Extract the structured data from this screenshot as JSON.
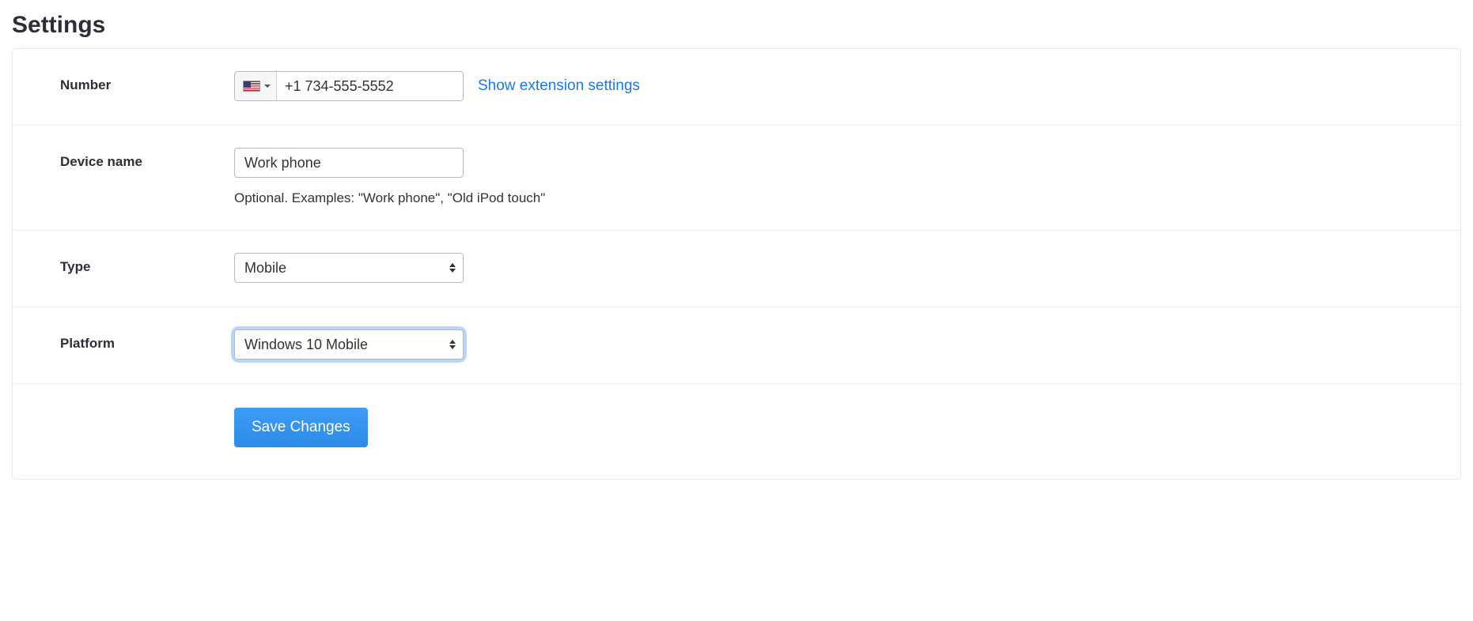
{
  "title": "Settings",
  "number": {
    "label": "Number",
    "value": "+1 734-555-5552",
    "flag": "us",
    "extension_link": "Show extension settings"
  },
  "device_name": {
    "label": "Device name",
    "value": "Work phone",
    "helper": "Optional. Examples: \"Work phone\", \"Old iPod touch\""
  },
  "type": {
    "label": "Type",
    "value": "Mobile"
  },
  "platform": {
    "label": "Platform",
    "value": "Windows 10 Mobile"
  },
  "actions": {
    "save": "Save Changes"
  }
}
